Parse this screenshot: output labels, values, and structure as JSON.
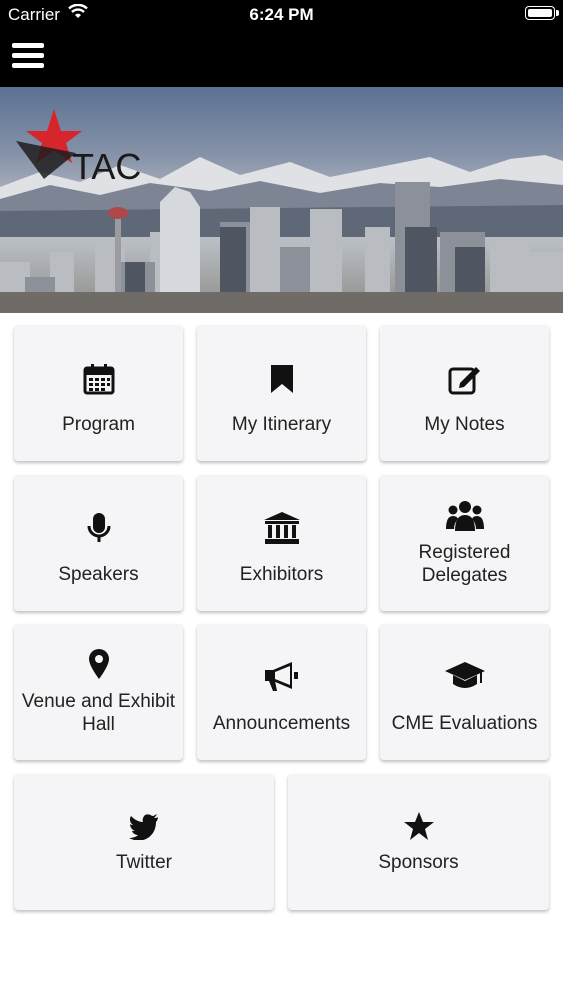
{
  "status_bar": {
    "carrier": "Carrier",
    "time": "6:24 PM"
  },
  "banner": {
    "logo_text": "TAC"
  },
  "tiles": [
    {
      "label": "Program",
      "icon": "calendar-icon"
    },
    {
      "label": "My Itinerary",
      "icon": "bookmark-icon"
    },
    {
      "label": "My Notes",
      "icon": "edit-note-icon"
    },
    {
      "label": "Speakers",
      "icon": "microphone-icon"
    },
    {
      "label": "Exhibitors",
      "icon": "building-columns-icon"
    },
    {
      "label": "Registered Delegates",
      "icon": "users-icon"
    },
    {
      "label": "Venue and Exhibit Hall",
      "icon": "map-pin-icon"
    },
    {
      "label": "Announcements",
      "icon": "megaphone-icon"
    },
    {
      "label": "CME Evaluations",
      "icon": "graduation-cap-icon"
    },
    {
      "label": "Twitter",
      "icon": "twitter-icon"
    },
    {
      "label": "Sponsors",
      "icon": "star-icon"
    }
  ]
}
